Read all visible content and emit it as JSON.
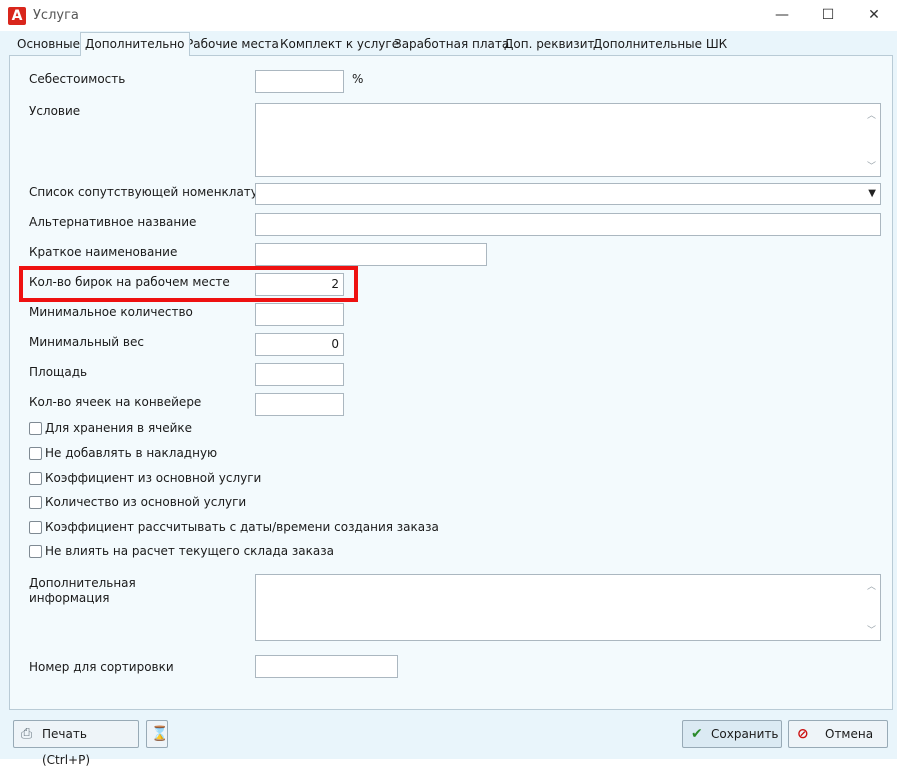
{
  "window": {
    "title": "Услуга",
    "app_icon_letter": "A",
    "minimize_glyph": "—",
    "maximize_glyph": "☐",
    "close_glyph": "✕"
  },
  "tabs": [
    {
      "label": "Основные"
    },
    {
      "label": "Дополнительно",
      "active": true
    },
    {
      "label": "Рабочие места"
    },
    {
      "label": "Комплект к услуге"
    },
    {
      "label": "Заработная плата"
    },
    {
      "label": "Доп. реквизит"
    },
    {
      "label": "Дополнительные ШК"
    }
  ],
  "form": {
    "cost_label": "Себестоимость",
    "cost_value": "",
    "cost_unit": "%",
    "condition_label": "Условие",
    "condition_value": "",
    "related_list_label": "Список сопутствующей номенклатуры",
    "related_list_value": "",
    "alt_name_label": "Альтернативное название",
    "alt_name_value": "",
    "short_name_label": "Краткое наименование",
    "short_name_value": "",
    "tags_label": "Кол-во бирок на рабочем месте",
    "tags_value": "2",
    "min_qty_label": "Минимальное количество",
    "min_qty_value": "",
    "min_weight_label": "Минимальный вес",
    "min_weight_value": "0",
    "area_label": "Площадь",
    "area_value": "",
    "cells_label": "Кол-во ячеек на конвейере",
    "cells_value": "",
    "checkboxes": [
      {
        "label": "Для хранения в ячейке",
        "checked": false
      },
      {
        "label": "Не добавлять в накладную",
        "checked": false
      },
      {
        "label": "Коэффициент из основной услуги",
        "checked": false
      },
      {
        "label": "Количество из основной услуги",
        "checked": false
      },
      {
        "label": "Коэффициент рассчитывать с даты/времени создания заказа",
        "checked": false
      },
      {
        "label": "Не влиять на расчет текущего склада заказа",
        "checked": false
      }
    ],
    "additional_info_label_line1": "Дополнительная",
    "additional_info_label_line2": "информация",
    "additional_info_value": "",
    "sort_number_label": "Номер для сортировки",
    "sort_number_value": ""
  },
  "buttons": {
    "print_label": "Печать (Ctrl+P)",
    "save_label": "Сохранить",
    "cancel_label": "Отмена"
  },
  "colors": {
    "highlight": "#ee1111",
    "background": "#e9f5fb",
    "app_icon": "#d9261c"
  }
}
